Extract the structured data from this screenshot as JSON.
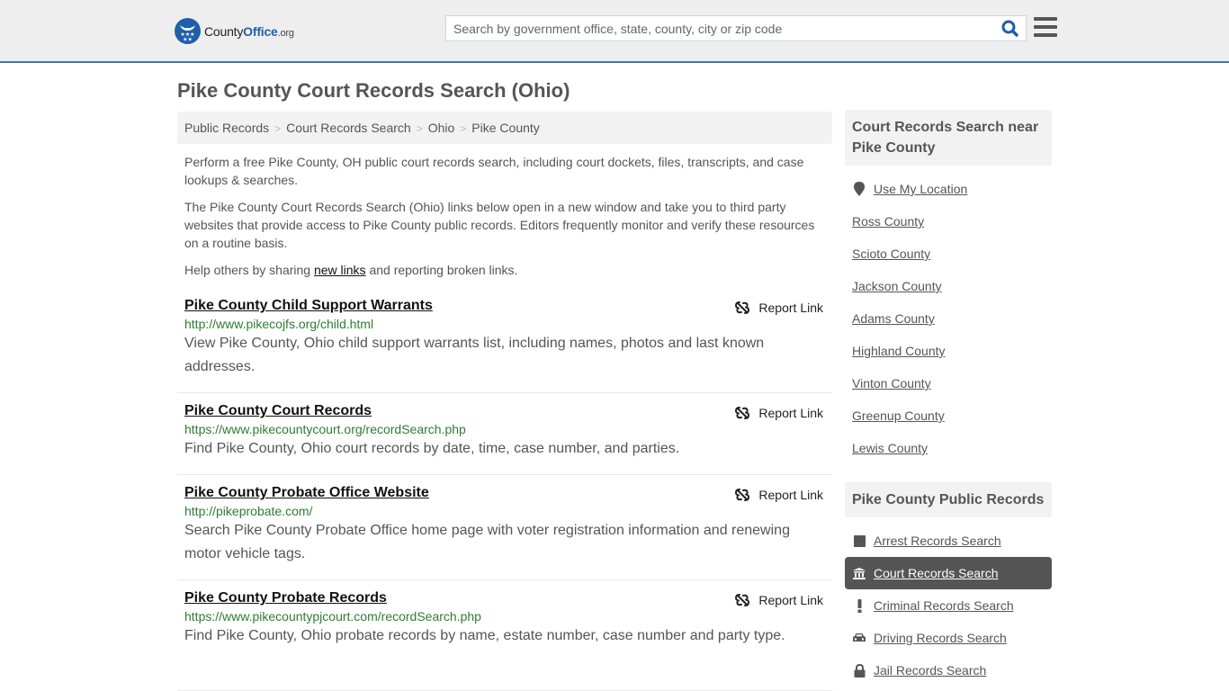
{
  "header": {
    "logo": {
      "county": "County",
      "office": "Office",
      "org": ".org"
    },
    "search_placeholder": "Search by government office, state, county, city or zip code",
    "search_value": "",
    "colors": {
      "brand": "#1f5fa8",
      "header_bg": "#eeeeee",
      "header_border": "#3a7bb0"
    }
  },
  "page": {
    "title": "Pike County Court Records Search (Ohio)"
  },
  "breadcrumb": [
    "Public Records",
    "Court Records Search",
    "Ohio",
    "Pike County"
  ],
  "intro": {
    "p1": "Perform a free Pike County, OH public court records search, including court dockets, files, transcripts, and case lookups & searches.",
    "p2": "The Pike County Court Records Search (Ohio) links below open in a new window and take you to third party websites that provide access to Pike County public records. Editors frequently monitor and verify these resources on a routine basis.",
    "p3_before": "Help others by sharing ",
    "p3_link": "new links",
    "p3_after": " and reporting broken links."
  },
  "listings": [
    {
      "title": "Pike County Child Support Warrants",
      "url": "http://www.pikecojfs.org/child.html",
      "description": "View Pike County, Ohio child support warrants list, including names, photos and last known addresses.",
      "report_label": "Report Link"
    },
    {
      "title": "Pike County Court Records",
      "url": "https://www.pikecountycourt.org/recordSearch.php",
      "description": "Find Pike County, Ohio court records by date, time, case number, and parties.",
      "report_label": "Report Link"
    },
    {
      "title": "Pike County Probate Office Website",
      "url": "http://pikeprobate.com/",
      "description": "Search Pike County Probate Office home page with voter registration information and renewing motor vehicle tags.",
      "report_label": "Report Link"
    },
    {
      "title": "Pike County Probate Records",
      "url": "https://www.pikecountypjcourt.com/recordSearch.php",
      "description": "Find Pike County, Ohio probate records by name, estate number, case number and party type.",
      "report_label": "Report Link"
    }
  ],
  "sidebar": {
    "nearby": {
      "heading": "Court Records Search near Pike County",
      "use_location": "Use My Location",
      "counties": [
        "Ross County",
        "Scioto County",
        "Jackson County",
        "Adams County",
        "Highland County",
        "Vinton County",
        "Greenup County",
        "Lewis County"
      ]
    },
    "public_records": {
      "heading": "Pike County Public Records",
      "items": [
        {
          "label": "Arrest Records Search",
          "icon": "square-icon",
          "active": false
        },
        {
          "label": "Court Records Search",
          "icon": "courthouse-icon",
          "active": true
        },
        {
          "label": "Criminal Records Search",
          "icon": "exclamation-icon",
          "active": false
        },
        {
          "label": "Driving Records Search",
          "icon": "car-icon",
          "active": false
        },
        {
          "label": "Jail Records Search",
          "icon": "lock-icon",
          "active": false
        }
      ]
    }
  }
}
